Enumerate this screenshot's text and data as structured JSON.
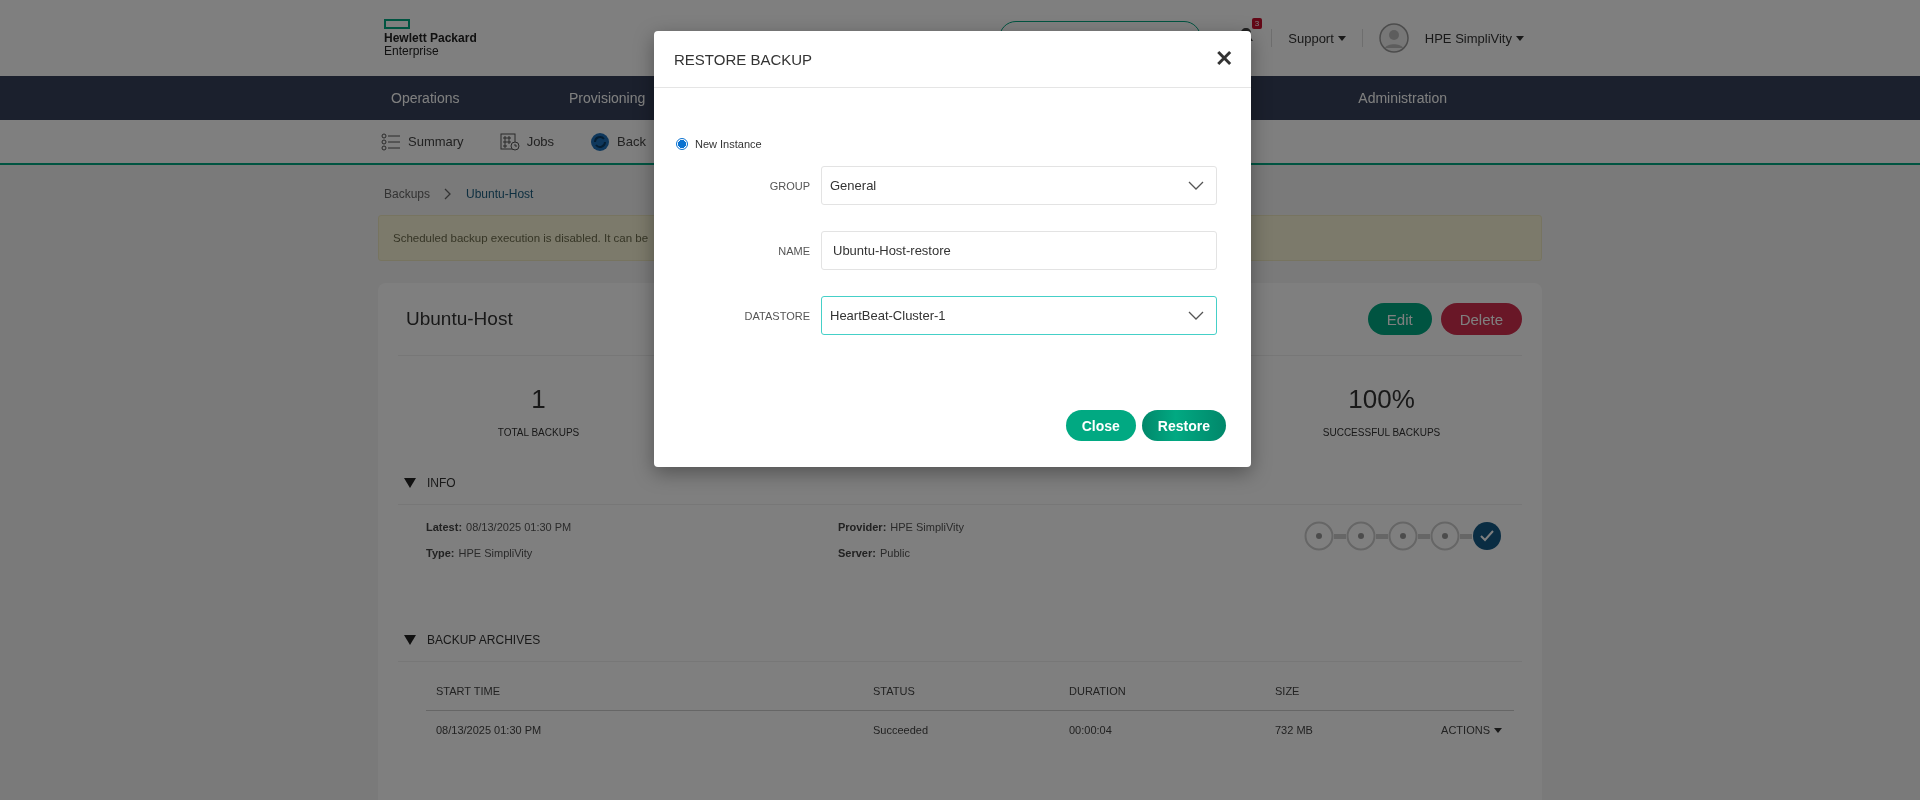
{
  "header": {
    "logo_line1": "Hewlett Packard",
    "logo_line2": "Enterprise",
    "notification_count": "3",
    "support_menu": "Support",
    "user_menu": "HPE SimpliVity"
  },
  "nav": [
    {
      "label": "Operations"
    },
    {
      "label": "Provisioning"
    },
    {
      "label": "Administration"
    }
  ],
  "subnav": [
    {
      "label": "Summary",
      "kind": "summary"
    },
    {
      "label": "Jobs",
      "kind": "jobs"
    },
    {
      "label": "Back",
      "kind": "backups"
    }
  ],
  "breadcrumb": [
    "Backups",
    "Ubuntu-Host"
  ],
  "alert": "Scheduled backup execution is disabled. It can be",
  "card": {
    "title": "Ubuntu-Host",
    "buttons": [
      {
        "label": "Edit",
        "kind": "primary"
      },
      {
        "label": "Delete",
        "kind": "danger"
      }
    ],
    "stats": [
      {
        "value": "1",
        "label": "TOTAL BACKUPS"
      },
      {
        "value": "100%",
        "label": "SUCCESSFUL BACKUPS"
      }
    ],
    "info": {
      "title": "INFO",
      "expanded": true,
      "fields": [
        {
          "label": "Latest:",
          "value": "08/13/2025 01:30 PM"
        },
        {
          "label": "Provider:",
          "value": "HPE SimpliVity"
        },
        {
          "label": "Type:",
          "value": "HPE SimpliVity"
        },
        {
          "label": "Server:",
          "value": "Public"
        }
      ],
      "steps": [
        {
          "done": false
        },
        {
          "done": false
        },
        {
          "done": false
        },
        {
          "done": false
        },
        {
          "done": true
        }
      ]
    },
    "archives": {
      "title": "BACKUP ARCHIVES",
      "expanded": true,
      "columns": [
        "START TIME",
        "STATUS",
        "DURATION",
        "SIZE"
      ],
      "rows": [
        {
          "cells": [
            "08/13/2025 01:30 PM",
            "Succeeded",
            "00:00:04",
            "732 MB"
          ],
          "actions": "ACTIONS"
        }
      ]
    }
  },
  "modal": {
    "title": "RESTORE BACKUP",
    "close": "✕",
    "option": {
      "label": "New Instance",
      "selected": true
    },
    "fields": [
      {
        "label": "GROUP",
        "value": "General",
        "kind": "select",
        "focused": false
      },
      {
        "label": "NAME",
        "value": "Ubuntu-Host-restore",
        "kind": "text",
        "focused": false
      },
      {
        "label": "DATASTORE",
        "value": "HeartBeat-Cluster-1",
        "kind": "select",
        "focused": true
      }
    ],
    "buttons": [
      {
        "label": "Close",
        "kind": "secondary"
      },
      {
        "label": "Restore",
        "kind": "primary"
      }
    ]
  }
}
